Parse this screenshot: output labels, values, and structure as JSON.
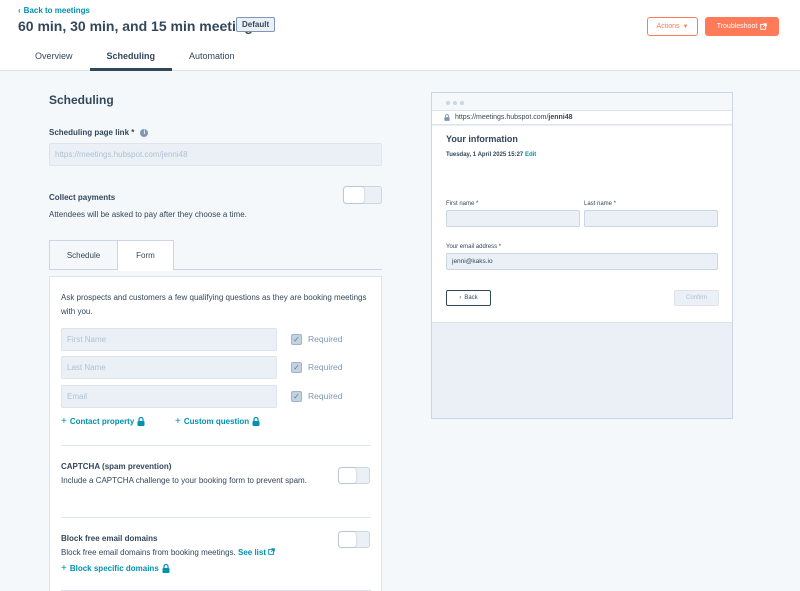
{
  "header": {
    "back_label": "Back to meetings",
    "title": "60 min, 30 min, and 15 min meeting",
    "badge": "Default",
    "actions_label": "Actions",
    "troubleshoot_label": "Troubleshoot"
  },
  "tabs": [
    {
      "label": "Overview",
      "active": false
    },
    {
      "label": "Scheduling",
      "active": true
    },
    {
      "label": "Automation",
      "active": false
    }
  ],
  "scheduling": {
    "title": "Scheduling",
    "link_label": "Scheduling page link *",
    "link_value": "https://meetings.hubspot.com/jenni48",
    "collect_payments_title": "Collect payments",
    "collect_payments_desc": "Attendees will be asked to pay after they choose a time.",
    "collect_payments_on": false
  },
  "subtabs": [
    {
      "label": "Schedule",
      "active": false
    },
    {
      "label": "Form",
      "active": true
    }
  ],
  "form": {
    "description": "Ask prospects and customers a few qualifying questions as they are booking meetings with you.",
    "fields": [
      {
        "placeholder": "First Name",
        "required_label": "Required",
        "checked": true
      },
      {
        "placeholder": "Last Name",
        "required_label": "Required",
        "checked": true
      },
      {
        "placeholder": "Email",
        "required_label": "Required",
        "checked": true
      }
    ],
    "contact_property_label": "Contact property",
    "custom_question_label": "Custom question",
    "captcha_title": "CAPTCHA (spam prevention)",
    "captcha_desc": "Include a CAPTCHA challenge to your booking form to prevent spam.",
    "block_title": "Block free email domains",
    "block_desc": "Block free email domains from booking meetings.",
    "see_list_label": "See list",
    "block_specific_label": "Block specific domains"
  },
  "preview": {
    "url_prefix": "https://meetings.hubspot.com/",
    "url_user": "jenni48",
    "title": "Your information",
    "date": "Tuesday, 1 April 2025 15:27",
    "edit_label": "Edit",
    "first_name_label": "First name *",
    "last_name_label": "Last name *",
    "email_label": "Your email address *",
    "email_value": "jenni@kaks.io",
    "back_label": "Back",
    "confirm_label": "Confirm"
  },
  "colors": {
    "accent": "#ff7a59",
    "link": "#0091ae",
    "text": "#33475b"
  }
}
